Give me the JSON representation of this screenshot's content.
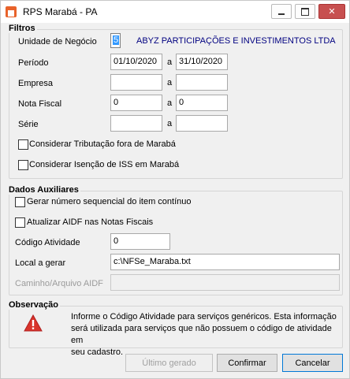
{
  "window": {
    "title": "RPS Marabá - PA"
  },
  "filtros": {
    "title": "Filtros",
    "unidade_label": "Unidade de Negócio",
    "unidade_code": "5",
    "unidade_name": "ABYZ PARTICIPAÇÕES E INVESTIMENTOS LTDA",
    "periodo_label": "Período",
    "periodo_from": "01/10/2020",
    "periodo_to": "31/10/2020",
    "empresa_label": "Empresa",
    "empresa_from": "",
    "empresa_to": "",
    "nota_label": "Nota Fiscal",
    "nota_from": "0",
    "nota_to": "0",
    "serie_label": "Série",
    "serie_from": "",
    "serie_to": "",
    "range_sep": "a",
    "chk_tributacao": "Considerar Tributação fora de Marabá",
    "chk_isencao": "Considerar Isenção de ISS em Marabá"
  },
  "auxiliares": {
    "title": "Dados Auxiliares",
    "chk_sequencial": "Gerar número sequencial do item contínuo",
    "chk_aidf": "Atualizar AIDF nas Notas Fiscais",
    "codigo_label": "Código Atividade",
    "codigo_value": "0",
    "local_label": "Local a gerar",
    "local_value": "c:\\NFSe_Maraba.txt",
    "caminho_label": "Caminho/Arquivo AIDF",
    "caminho_value": ""
  },
  "observacao": {
    "title": "Observação",
    "line1": "Informe o Código Atividade para serviços genéricos. Esta informação",
    "line2": "será utilizada para serviços que não possuem o código de atividade em",
    "line3": "seu cadastro."
  },
  "buttons": {
    "ultimo": "Último gerado",
    "confirmar": "Confirmar",
    "cancelar": "Cancelar"
  },
  "colors": {
    "accent": "#0078d7",
    "company_text": "#000080",
    "warning": "#d9342b",
    "close": "#c75050"
  },
  "icons": {
    "app": "app-house-icon",
    "warning": "warning-icon"
  }
}
